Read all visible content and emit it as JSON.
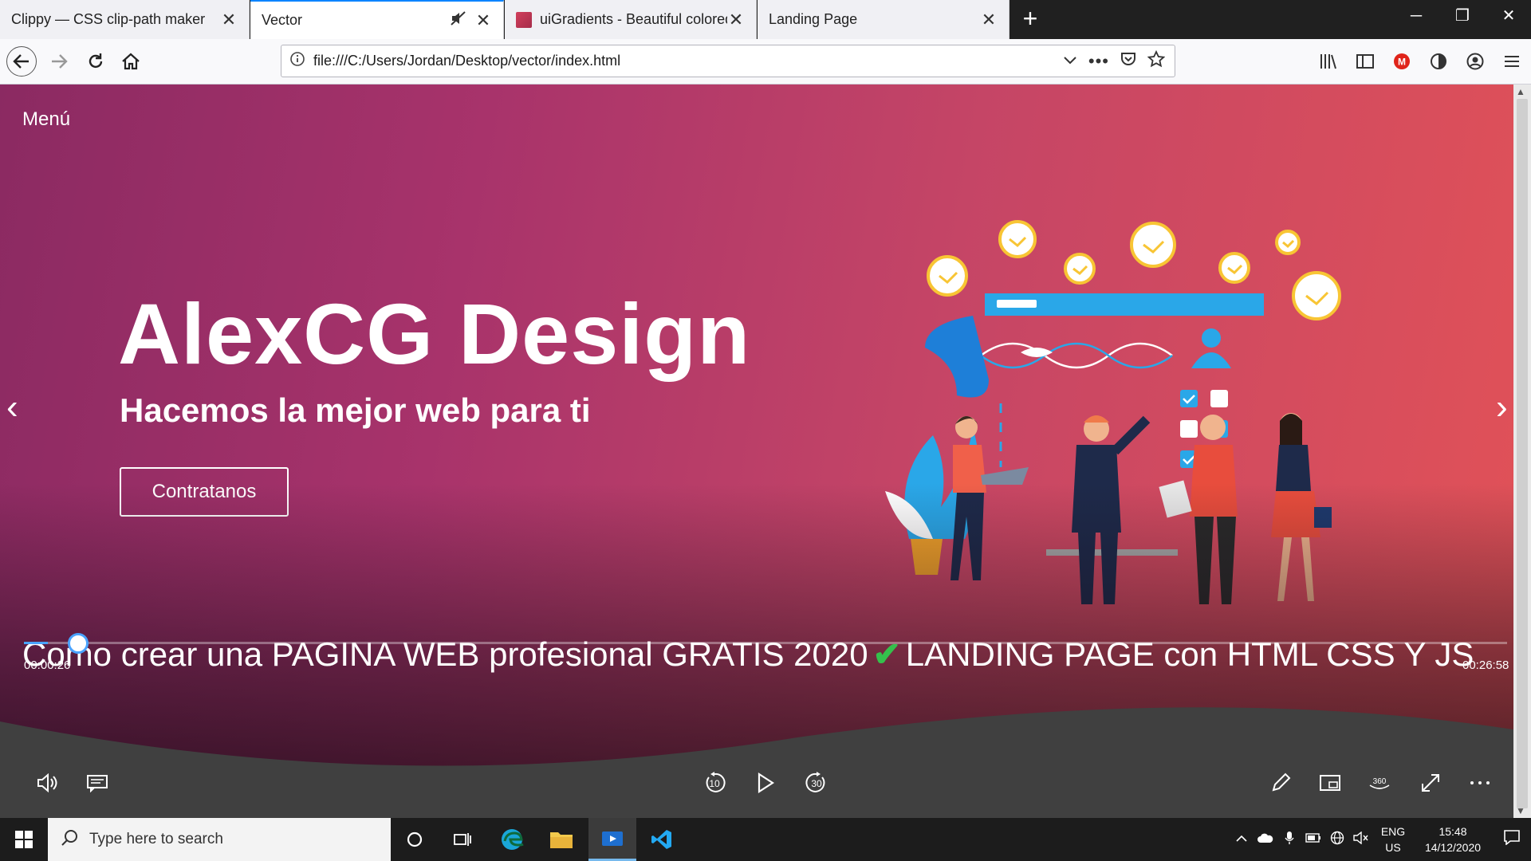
{
  "browser": {
    "tabs": [
      {
        "title": "Clippy — CSS clip-path maker",
        "close": "✕"
      },
      {
        "title": "Vector",
        "close": "✕",
        "muted_icon": "speaker-muted-icon"
      },
      {
        "title": "uiGradients - Beautiful colored",
        "close": "✕"
      },
      {
        "title": "Landing Page",
        "close": "✕"
      }
    ],
    "new_tab": "+",
    "window_controls": {
      "minimize": "─",
      "restore": "❐",
      "close": "✕"
    },
    "url": "file:///C:/Users/Jordan/Desktop/vector/index.html",
    "accent_color": "#0a84ff"
  },
  "page": {
    "menu_label": "Menú",
    "title": "AlexCG Design",
    "subtitle": "Hacemos la mejor web para ti",
    "cta_label": "Contratanos",
    "gradient": [
      "#8b2a62",
      "#e25257"
    ],
    "carousel_prev": "‹",
    "carousel_next": "›"
  },
  "player": {
    "video_title": "Como crear una PAGINA WEB profesional GRATIS 2020",
    "check_mark": "✔",
    "video_title_suffix": "LANDING PAGE con HTML CSS Y JS",
    "current_time": "00:00:26",
    "total_time": "00:26:58",
    "progress_fraction": 0.016,
    "skip_back_seconds": "10",
    "skip_forward_seconds": "30",
    "progress_color": "#49a3ff"
  },
  "taskbar": {
    "search_placeholder": "Type here to search",
    "language_line1": "ENG",
    "language_line2": "US",
    "time": "15:48",
    "date": "14/12/2020"
  }
}
